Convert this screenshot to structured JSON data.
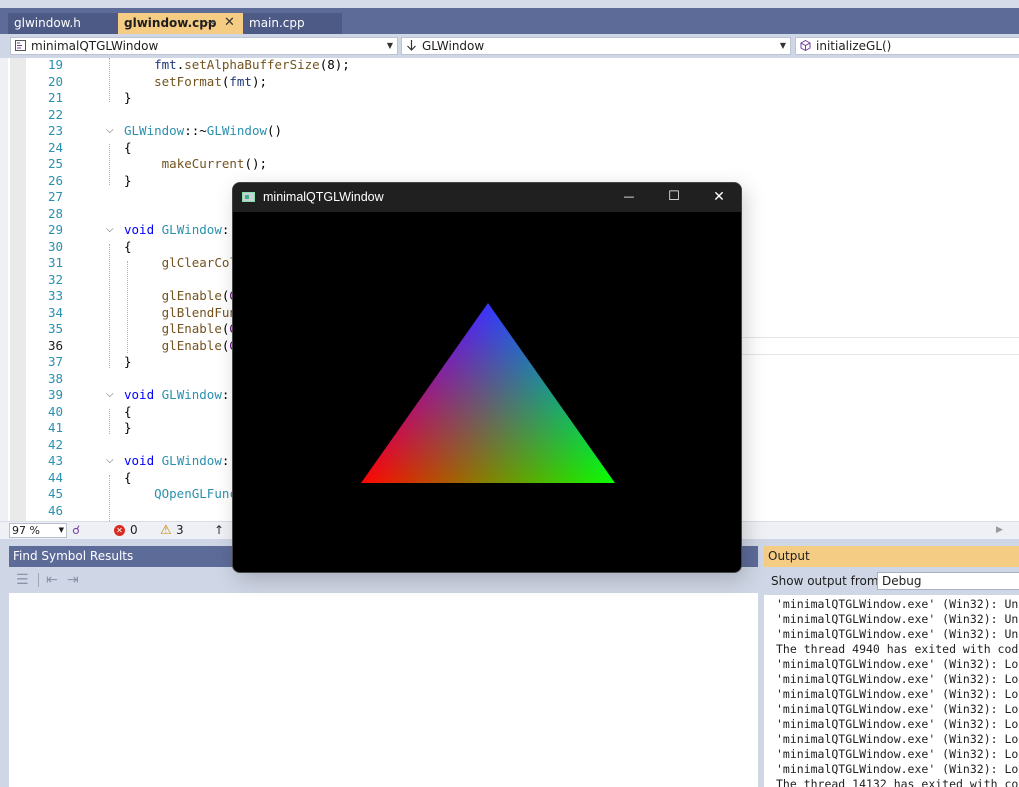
{
  "tabs": [
    {
      "label": "glwindow.h",
      "active": false
    },
    {
      "label": "glwindow.cpp",
      "active": true,
      "pin": "⊸",
      "close": "✕"
    },
    {
      "label": "main.cpp",
      "active": false
    }
  ],
  "nav": {
    "project": "minimalQTGLWindow",
    "scope": "GLWindow",
    "member": "initializeGL()"
  },
  "editor": {
    "lines": [
      {
        "n": "19",
        "code": "    fmt.setAlphaBufferSize(8);"
      },
      {
        "n": "20",
        "code": "    setFormat(fmt);"
      },
      {
        "n": "21",
        "code": "}"
      },
      {
        "n": "22",
        "code": ""
      },
      {
        "n": "23",
        "code": "GLWindow::~GLWindow()"
      },
      {
        "n": "24",
        "code": "{"
      },
      {
        "n": "25",
        "code": "     makeCurrent();"
      },
      {
        "n": "26",
        "code": "}"
      },
      {
        "n": "27",
        "code": ""
      },
      {
        "n": "28",
        "code": ""
      },
      {
        "n": "29",
        "code": "void GLWindow::"
      },
      {
        "n": "30",
        "code": "{"
      },
      {
        "n": "31",
        "code": "     glClearColo"
      },
      {
        "n": "32",
        "code": ""
      },
      {
        "n": "33",
        "code": "     glEnable(GL"
      },
      {
        "n": "34",
        "code": "     glBlendFunc"
      },
      {
        "n": "35",
        "code": "     glEnable(GL"
      },
      {
        "n": "36",
        "code": "     glEnable(GL"
      },
      {
        "n": "37",
        "code": "}"
      },
      {
        "n": "38",
        "code": ""
      },
      {
        "n": "39",
        "code": "void GLWindow::"
      },
      {
        "n": "40",
        "code": "{"
      },
      {
        "n": "41",
        "code": "}"
      },
      {
        "n": "42",
        "code": ""
      },
      {
        "n": "43",
        "code": "void GLWindow::"
      },
      {
        "n": "44",
        "code": "{"
      },
      {
        "n": "45",
        "code": "    QOpenGLFunct"
      },
      {
        "n": "46",
        "code": ""
      }
    ],
    "current_line": "36"
  },
  "status": {
    "zoom": "97 %",
    "errors": "0",
    "warnings": "3"
  },
  "find_panel": {
    "title": "Find Symbol Results"
  },
  "output_panel": {
    "title": "Output",
    "show_from_label": "Show output from:",
    "show_from_value": "Debug",
    "lines": [
      "'minimalQTGLWindow.exe' (Win32): Un",
      "'minimalQTGLWindow.exe' (Win32): Un",
      "'minimalQTGLWindow.exe' (Win32): Un",
      "The thread 4940 has exited with cod",
      "'minimalQTGLWindow.exe' (Win32): Lo",
      "'minimalQTGLWindow.exe' (Win32): Lo",
      "'minimalQTGLWindow.exe' (Win32): Lo",
      "'minimalQTGLWindow.exe' (Win32): Lo",
      "'minimalQTGLWindow.exe' (Win32): Lo",
      "'minimalQTGLWindow.exe' (Win32): Lo",
      "'minimalQTGLWindow.exe' (Win32): Lo",
      "'minimalQTGLWindow.exe' (Win32): Lo",
      "The thread 14132 has exited with co"
    ]
  },
  "qt_window": {
    "title": "minimalQTGLWindow",
    "minimize": "—",
    "maximize": "☐",
    "close": "✕"
  },
  "colors": {
    "tab_bar": "#5d6b99",
    "active_tab": "#f5cc84",
    "keyword": "#0000ff",
    "type": "#2b91af",
    "triangle_top": "#0000ff",
    "triangle_left": "#ff0000",
    "triangle_right": "#00ff00"
  }
}
